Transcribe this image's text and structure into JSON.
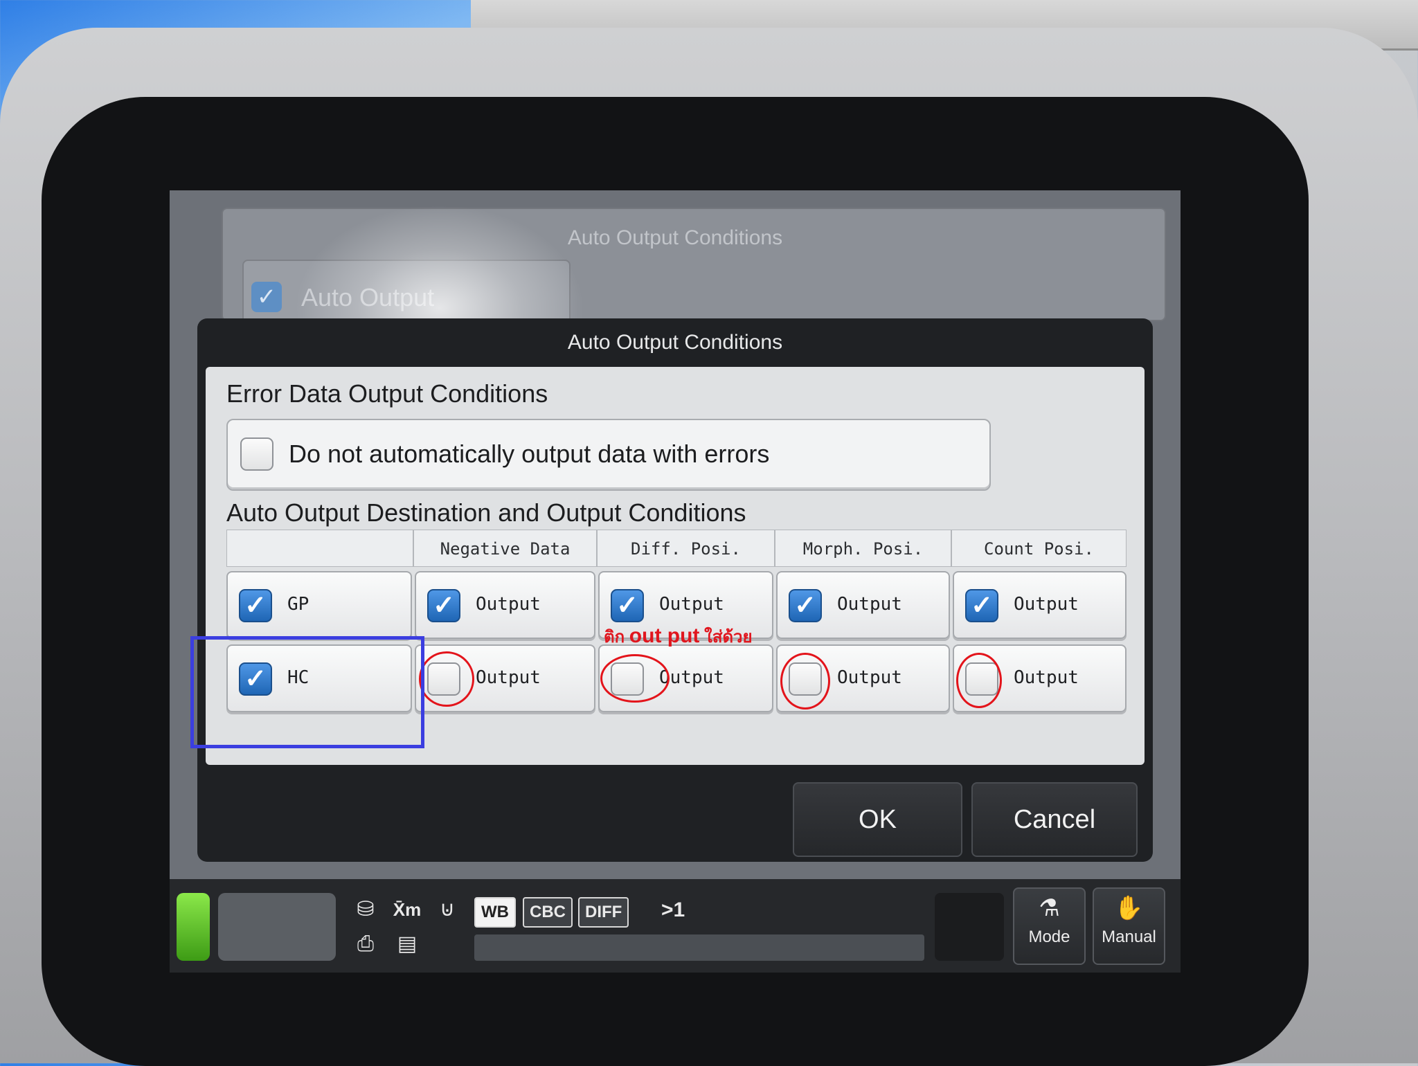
{
  "background_dialog": {
    "title": "Auto Output Conditions",
    "auto_output_label": "Auto Output",
    "auto_output_checked": true
  },
  "dialog": {
    "title": "Auto Output Conditions",
    "error_section": {
      "title": "Error Data Output Conditions",
      "option_label": "Do not automatically output data with errors",
      "option_checked": false
    },
    "destination_section": {
      "title": "Auto Output Destination and Output Conditions",
      "columns": [
        "",
        "Negative Data",
        "Diff. Posi.",
        "Morph. Posi.",
        "Count Posi."
      ],
      "rows": [
        {
          "destination": "GP",
          "destination_checked": true,
          "cells": [
            {
              "label": "Output",
              "checked": true
            },
            {
              "label": "Output",
              "checked": true
            },
            {
              "label": "Output",
              "checked": true
            },
            {
              "label": "Output",
              "checked": true
            }
          ]
        },
        {
          "destination": "HC",
          "destination_checked": true,
          "cells": [
            {
              "label": "Output",
              "checked": false
            },
            {
              "label": "Output",
              "checked": false
            },
            {
              "label": "Output",
              "checked": false
            },
            {
              "label": "Output",
              "checked": false
            }
          ]
        }
      ]
    },
    "ok_label": "OK",
    "cancel_label": "Cancel"
  },
  "annotation": {
    "text_prefix": "ติก",
    "text_big": "out put",
    "text_suffix": "ใส่ด้วย",
    "color": "#e0161e",
    "highlight_color": "#3b3ee0"
  },
  "statusbar": {
    "mode_tags": [
      "WB",
      "CBC",
      "DIFF"
    ],
    "count_text": ">1",
    "icons": [
      "xm-icon",
      "sample-icon",
      "printer-icon",
      "list-icon",
      "tube-icon"
    ],
    "xm_label": "X̄m",
    "mode_button_label": "Mode",
    "manual_button_label": "Manual",
    "led_color": "#5fc42a"
  }
}
